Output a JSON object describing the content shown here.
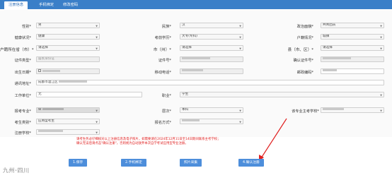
{
  "tabs": [
    {
      "label": "注册信息"
    },
    {
      "label": "手机绑定"
    },
    {
      "label": "修改密码"
    }
  ],
  "fields": {
    "gender": {
      "label": "性别*",
      "value": "男"
    },
    "ethnicity": {
      "label": "民族*",
      "value": "汉"
    },
    "politics": {
      "label": "政治面貌*",
      "value": "共青团员"
    },
    "health": {
      "label": "健康状况*",
      "value": "健康"
    },
    "education": {
      "label": "考前学历*",
      "value": "大专(专科)"
    },
    "hukou": {
      "label": "户籍情况*",
      "value": "城镇"
    },
    "province": {
      "label": "户籍所在省（市）*",
      "value": "请选择"
    },
    "city": {
      "label": "市（州）*",
      "value": "请选择"
    },
    "district": {
      "label": "县（市、区）*",
      "value": "请选择"
    },
    "id_type": {
      "label": "证件类型*",
      "value": "居民身份证"
    },
    "id_number": {
      "label": "证件号*",
      "value": ""
    },
    "id_confirm": {
      "label": "确认证件号*",
      "value": ""
    },
    "birthdate": {
      "label": "出生日期*",
      "value": ""
    },
    "mobile": {
      "label": "移动电话*",
      "value": ""
    },
    "postcode": {
      "label": "邮政编码*",
      "value": ""
    },
    "address": {
      "label": "通讯地址*",
      "value": "成都市温江区"
    },
    "employer": {
      "label": "工作单位*",
      "value": "无"
    },
    "occupation": {
      "label": "职业*",
      "value": "学生"
    },
    "major": {
      "label": "报考专业*",
      "value": "W"
    },
    "level": {
      "label": "层次*",
      "value": "本科"
    },
    "main_school": {
      "label": "该专业主考学校*",
      "value": ""
    },
    "candidate_type": {
      "label": "考生类别*",
      "value": "应用型考生"
    },
    "exam_mode": {
      "label": "报名方式*",
      "value": ""
    },
    "school": {
      "label": "注册学校*",
      "value": ""
    }
  },
  "notice": {
    "line1": "请考生务必仔细核对以上注册信息及电子照片，如需要请在2024年12月11日至14日期间联系主考学校；",
    "line2": "确认无误后请点击\"确认注册\"，否则视为自动放弃本次自学考试应用型专业注册。"
  },
  "buttons": {
    "save": "1.保存",
    "bind_phone": "2.手机绑定",
    "photo": "照片采集",
    "confirm": "4.确认注册"
  },
  "watermark": "九州·四川",
  "colors": {
    "header": "#3a7fc8",
    "button": "#4d8edb",
    "notice": "#e02020",
    "arrow": "#e02020"
  }
}
